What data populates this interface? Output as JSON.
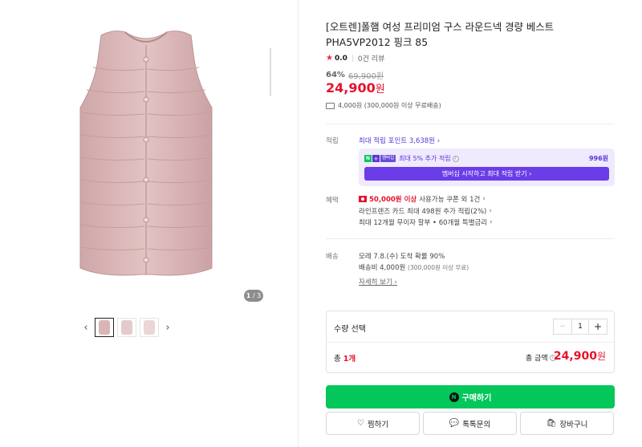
{
  "gallery": {
    "counter_current": "1",
    "counter_total": "/ 3",
    "prev_arrow": "‹",
    "next_arrow": "›"
  },
  "product": {
    "title": "[오트렌]폴햄 여성 프리미엄 구스 라운드넥 경량 베스트 PHA5VP2012 핑크 85",
    "rating": "0.0",
    "reviews": "0건 리뷰",
    "discount": "64%",
    "original_price": "69,900원",
    "price": "24,900",
    "price_unit": "원",
    "shipping_text": "4,000원 (300,000원 이상 무료배송)"
  },
  "points": {
    "label": "적립",
    "max_points_link": "최대 적립 포인트 3,638원 ›",
    "member_badge": "멤버십",
    "member_text": "최대 5% 추가 적립",
    "member_amount": "996원",
    "member_button": "멤버십 시작하고 최대 적립 받기 ›"
  },
  "benefits": {
    "label": "혜택",
    "coupon_strong": "50,000원 이상",
    "coupon_text": "사용가능 쿠폰 외 1건",
    "card_text": "라인프렌즈 카드 최대 498원 추가 적립(2%)",
    "installment_text": "최대 12개월 무이자 할부 • 60개월 특별금리"
  },
  "delivery": {
    "label": "배송",
    "arrival": "모레 7.8.(수) 도착 확률 90%",
    "fee": "배송비 4,000원",
    "fee_note": "(300,000원 이상 무료)",
    "details_link": "자세히 보기"
  },
  "quantity": {
    "label": "수량 선택",
    "value": "1",
    "minus": "−",
    "plus": "+",
    "total_count_prefix": "총 ",
    "total_count": "1개",
    "total_amount_label": "총 금액",
    "total_amount": "24,900",
    "total_unit": "원"
  },
  "buttons": {
    "buy": "구매하기",
    "buy_n": "N",
    "wish": "찜하기",
    "talk": "톡톡문의",
    "cart": "장바구니"
  },
  "colors": {
    "accent_red": "#e6122c",
    "naver_green": "#03c75a",
    "membership_purple": "#6a3de8"
  }
}
